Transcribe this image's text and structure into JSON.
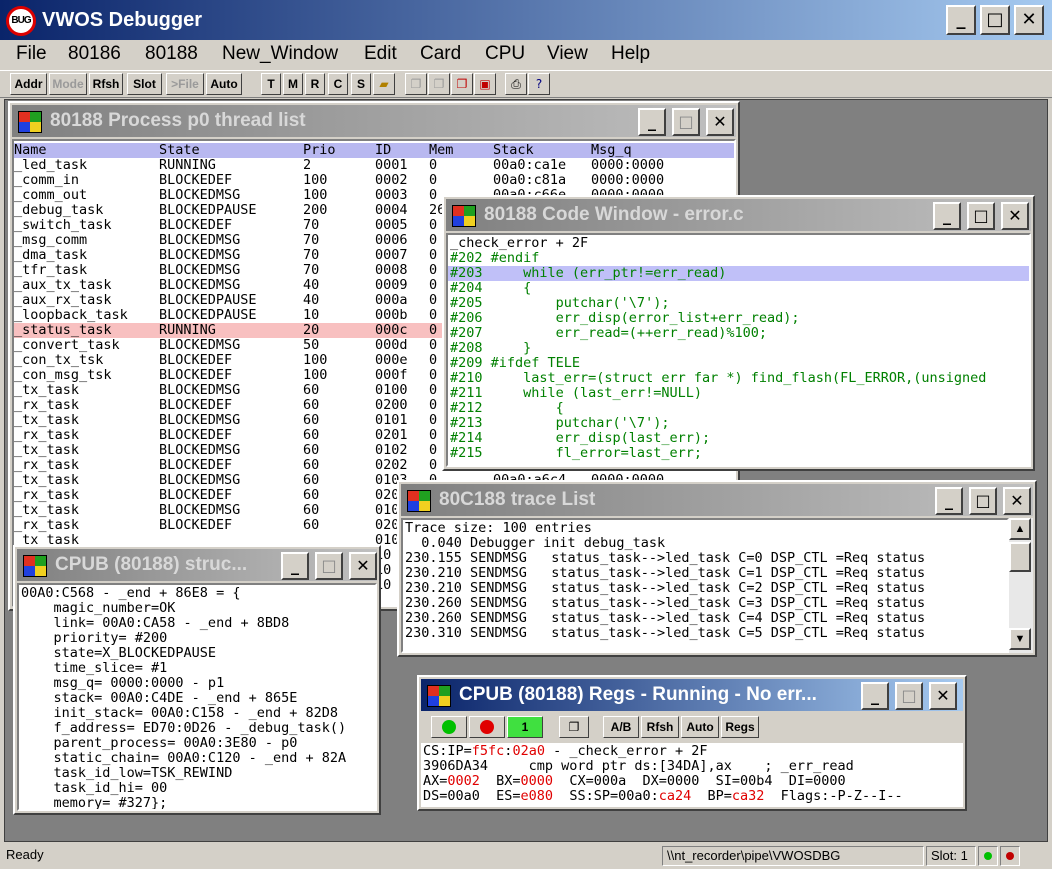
{
  "app": {
    "title": "VWOS Debugger",
    "icon_text": "BUG"
  },
  "menu": [
    "File",
    "80186",
    "80188",
    "New_Window",
    "Edit",
    "Card",
    "CPU",
    "View",
    "Help"
  ],
  "toolbar": {
    "text_buttons": [
      "Addr",
      "Mode",
      "Rfsh",
      "Slot",
      ">File",
      "Auto"
    ],
    "letter_buttons": [
      "T",
      "M",
      "R",
      "C",
      "S"
    ],
    "disabled": [
      "Mode",
      ">File"
    ],
    "icons": [
      "open-folder-icon",
      "copy-icon",
      "paste-icon",
      "window-copy-icon",
      "window-close-icon",
      "print-icon",
      "help-icon"
    ]
  },
  "thread_window": {
    "title": "80188 Process p0 thread list",
    "columns": [
      "Name",
      "State",
      "Prio",
      "ID",
      "Mem",
      "Stack",
      "Msg_q"
    ],
    "rows": [
      [
        "_led_task",
        "RUNNING",
        "2",
        "0001",
        "0",
        "00a0:ca1e",
        "0000:0000"
      ],
      [
        "_comm_in",
        "BLOCKEDEF",
        "100",
        "0002",
        "0",
        "00a0:c81a",
        "0000:0000"
      ],
      [
        "_comm_out",
        "BLOCKEDMSG",
        "100",
        "0003",
        "0",
        "00a0:c66e",
        "0000:0000"
      ],
      [
        "_debug_task",
        "BLOCKEDPAUSE",
        "200",
        "0004",
        "26",
        "",
        ""
      ],
      [
        "_switch_task",
        "BLOCKEDEF",
        "70",
        "0005",
        "0",
        "",
        ""
      ],
      [
        "_msg_comm",
        "BLOCKEDMSG",
        "70",
        "0006",
        "0",
        "",
        ""
      ],
      [
        "_dma_task",
        "BLOCKEDMSG",
        "70",
        "0007",
        "0",
        "",
        ""
      ],
      [
        "_tfr_task",
        "BLOCKEDMSG",
        "70",
        "0008",
        "0",
        "",
        ""
      ],
      [
        "_aux_tx_task",
        "BLOCKEDMSG",
        "40",
        "0009",
        "0",
        "",
        ""
      ],
      [
        "_aux_rx_task",
        "BLOCKEDPAUSE",
        "40",
        "000a",
        "0",
        "",
        ""
      ],
      [
        "_loopback_task",
        "BLOCKEDPAUSE",
        "10",
        "000b",
        "0",
        "",
        ""
      ],
      [
        "_status_task",
        "RUNNING",
        "20",
        "000c",
        "0",
        "",
        ""
      ],
      [
        "_convert_task",
        "BLOCKEDMSG",
        "50",
        "000d",
        "0",
        "",
        ""
      ],
      [
        "_con_tx_tsk",
        "BLOCKEDEF",
        "100",
        "000e",
        "0",
        "",
        ""
      ],
      [
        "_con_msg_tsk",
        "BLOCKEDEF",
        "100",
        "000f",
        "0",
        "",
        ""
      ],
      [
        "_tx_task",
        "BLOCKEDMSG",
        "60",
        "0100",
        "0",
        "",
        ""
      ],
      [
        "_rx_task",
        "BLOCKEDEF",
        "60",
        "0200",
        "0",
        "",
        ""
      ],
      [
        "_tx_task",
        "BLOCKEDMSG",
        "60",
        "0101",
        "0",
        "",
        ""
      ],
      [
        "_rx_task",
        "BLOCKEDEF",
        "60",
        "0201",
        "0",
        "",
        ""
      ],
      [
        "_tx_task",
        "BLOCKEDMSG",
        "60",
        "0102",
        "0",
        "",
        ""
      ],
      [
        "_rx_task",
        "BLOCKEDEF",
        "60",
        "0202",
        "0",
        "",
        ""
      ],
      [
        "_tx_task",
        "BLOCKEDMSG",
        "60",
        "0103",
        "0",
        "00a0:a6c4",
        "0000:0000"
      ],
      [
        "_rx_task",
        "BLOCKEDEF",
        "60",
        "020",
        "",
        "",
        ""
      ],
      [
        "_tx_task",
        "BLOCKEDMSG",
        "60",
        "010",
        "",
        "",
        ""
      ],
      [
        "_rx_task",
        "BLOCKEDEF",
        "60",
        "020",
        "",
        "",
        ""
      ],
      [
        "_tx_task",
        "",
        "",
        "010",
        "",
        "",
        ""
      ],
      [
        "",
        "",
        "",
        "10",
        "",
        "",
        ""
      ],
      [
        "",
        "",
        "",
        "10",
        "",
        "",
        ""
      ],
      [
        "",
        "",
        "",
        "10",
        "",
        "",
        ""
      ]
    ]
  },
  "code_window": {
    "title": "80188 Code Window - error.c",
    "lines": [
      "_check_error + 2F",
      "#202 #endif",
      "#203     while (err_ptr!=err_read)",
      "#204     {",
      "#205         putchar('\\7');",
      "#206         err_disp(error_list+err_read);",
      "#207         err_read=(++err_read)%100;",
      "#208     }",
      "#209 #ifdef TELE",
      "#210     last_err=(struct err far *) find_flash(FL_ERROR,(unsigned",
      "#211     while (last_err!=NULL)",
      "#212         {",
      "#213         putchar('\\7');",
      "#214         err_disp(last_err);",
      "#215         fl_error=last_err;"
    ]
  },
  "trace_window": {
    "title": "80C188 trace List",
    "lines": [
      "Trace size: 100 entries",
      "  0.040 Debugger init debug_task",
      "230.155 SENDMSG   status_task-->led_task C=0 DSP_CTL =Req status",
      "230.210 SENDMSG   status_task-->led_task C=1 DSP_CTL =Req status",
      "230.210 SENDMSG   status_task-->led_task C=2 DSP_CTL =Req status",
      "230.260 SENDMSG   status_task-->led_task C=3 DSP_CTL =Req status",
      "230.260 SENDMSG   status_task-->led_task C=4 DSP_CTL =Req status",
      "230.310 SENDMSG   status_task-->led_task C=5 DSP_CTL =Req status"
    ]
  },
  "struct_window": {
    "title": "CPUB (80188) struc...",
    "lines": [
      "00A0:C568 - _end + 86E8 = {",
      "    magic_number=OK",
      "    link= 00A0:CA58 - _end + 8BD8",
      "    priority= #200",
      "    state=X_BLOCKEDPAUSE",
      "    time_slice= #1",
      "    msg_q= 0000:0000 - p1",
      "    stack= 00A0:C4DE - _end + 865E",
      "    init_stack= 00A0:C158 - _end + 82D8",
      "    f_address= ED70:0D26 - _debug_task()",
      "    parent_process= 00A0:3E80 - p0",
      "    static_chain= 00A0:C120 - _end + 82A",
      "    task_id_low=TSK_REWIND",
      "    task_id_hi= 00",
      "    memory= #327};"
    ]
  },
  "regs_window": {
    "title": "CPUB (80188) Regs - Running - No err...",
    "toolbar": [
      "1",
      "A/B",
      "Rfsh",
      "Auto",
      "Regs"
    ],
    "line1": {
      "prefix": "CS:IP=",
      "cs": "f5fc",
      "sep": ":",
      "ip": "02a0",
      "suffix": " - _check_error + 2F"
    },
    "line2": "3906DA34     cmp word ptr ds:[34DA],ax    ; _err_read",
    "line3": {
      "ax_label": "AX=",
      "ax": "0002",
      "bx_label": "  BX=",
      "bx": "0000",
      "rest": "  CX=000a  DX=0000  SI=00b4  DI=0000"
    },
    "line4": {
      "ds": "DS=00a0  ES=",
      "es": "e080",
      "ss_label": "  SS:SP=00a0:",
      "sp": "ca24",
      "bp_label": "  BP=",
      "bp": "ca32",
      "flags": "  Flags:-P-Z--I--"
    },
    "colors": {
      "go": "#00c000",
      "stop": "#e00000",
      "changed": "#e00000"
    }
  },
  "status": {
    "left": "Ready",
    "pipe": "\\\\nt_recorder\\pipe\\VWOSDBG",
    "slot": "Slot: 1"
  }
}
